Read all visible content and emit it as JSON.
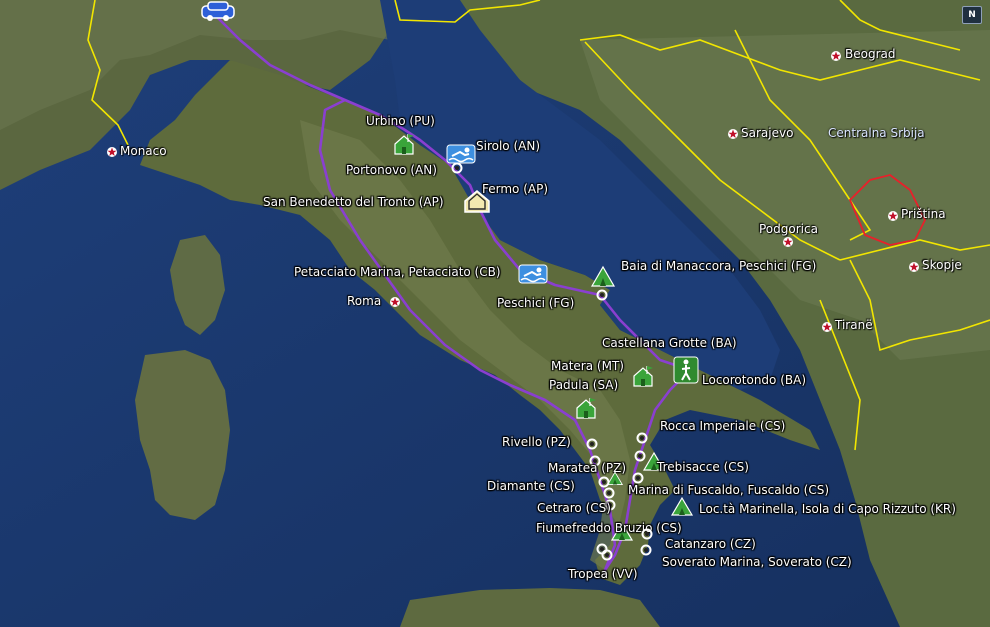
{
  "map": {
    "colors": {
      "sea": "#1c3b73",
      "land": "#5a6a3a",
      "border": "#f2e600",
      "route": "#8a3fd0",
      "region_border": "#e8202a"
    },
    "north_indicator": "N",
    "cities": [
      {
        "name": "Monaco",
        "label": "Monaco"
      },
      {
        "name": "Roma",
        "label": "Roma"
      },
      {
        "name": "Beograd",
        "label": "Beograd"
      },
      {
        "name": "Sarajevo",
        "label": "Sarajevo"
      },
      {
        "name": "Podgorica",
        "label": "Podgorica"
      },
      {
        "name": "Pristina",
        "label": "Priština"
      },
      {
        "name": "Skopje",
        "label": "Skopje"
      },
      {
        "name": "Tirane",
        "label": "Tiranë"
      }
    ],
    "regions": [
      {
        "name": "Centralna Srbija",
        "label": "Centralna Srbija"
      }
    ],
    "places": [
      {
        "label": "Urbino (PU)",
        "icon": "house-flag-icon"
      },
      {
        "label": "Sirolo (AN)",
        "icon": "swimmer-icon"
      },
      {
        "label": "Portonovo (AN)",
        "icon": "waypoint-icon"
      },
      {
        "label": "Fermo (AP)",
        "icon": "home-icon"
      },
      {
        "label": "San Benedetto del Tronto (AP)",
        "icon": "none"
      },
      {
        "label": "Petacciato Marina, Petacciato (CB)",
        "icon": "swimmer-icon"
      },
      {
        "label": "Baia di Manaccora, Peschici (FG)",
        "icon": "camping-tent-icon"
      },
      {
        "label": "Peschici (FG)",
        "icon": "waypoint-icon"
      },
      {
        "label": "Castellana Grotte (BA)",
        "icon": "none"
      },
      {
        "label": "Matera (MT)",
        "icon": "none"
      },
      {
        "label": "Padula (SA)",
        "icon": "house-flag-icon"
      },
      {
        "label": "Locorotondo (BA)",
        "icon": "hiker-icon"
      },
      {
        "label": "Rocca Imperiale (CS)",
        "icon": "waypoint-icon"
      },
      {
        "label": "Rivello (PZ)",
        "icon": "waypoint-icon"
      },
      {
        "label": "Maratea (PZ)",
        "icon": "waypoint-icon"
      },
      {
        "label": "Trebisacce (CS)",
        "icon": "camping-tent-icon"
      },
      {
        "label": "Diamante (CS)",
        "icon": "waypoint-icon"
      },
      {
        "label": "Marina di Fuscaldo, Fuscaldo (CS)",
        "icon": "waypoint-icon"
      },
      {
        "label": "Cetraro (CS)",
        "icon": "waypoint-icon"
      },
      {
        "label": "Loc.tà Marinella, Isola di Capo Rizzuto (KR)",
        "icon": "camping-tent-icon"
      },
      {
        "label": "Fiumefreddo Bruzio (CS)",
        "icon": "camping-tent-icon"
      },
      {
        "label": "Catanzaro (CZ)",
        "icon": "waypoint-icon"
      },
      {
        "label": "Soverato Marina, Soverato (CZ)",
        "icon": "waypoint-icon"
      },
      {
        "label": "Tropea (VV)",
        "icon": "waypoint-icon"
      }
    ]
  }
}
